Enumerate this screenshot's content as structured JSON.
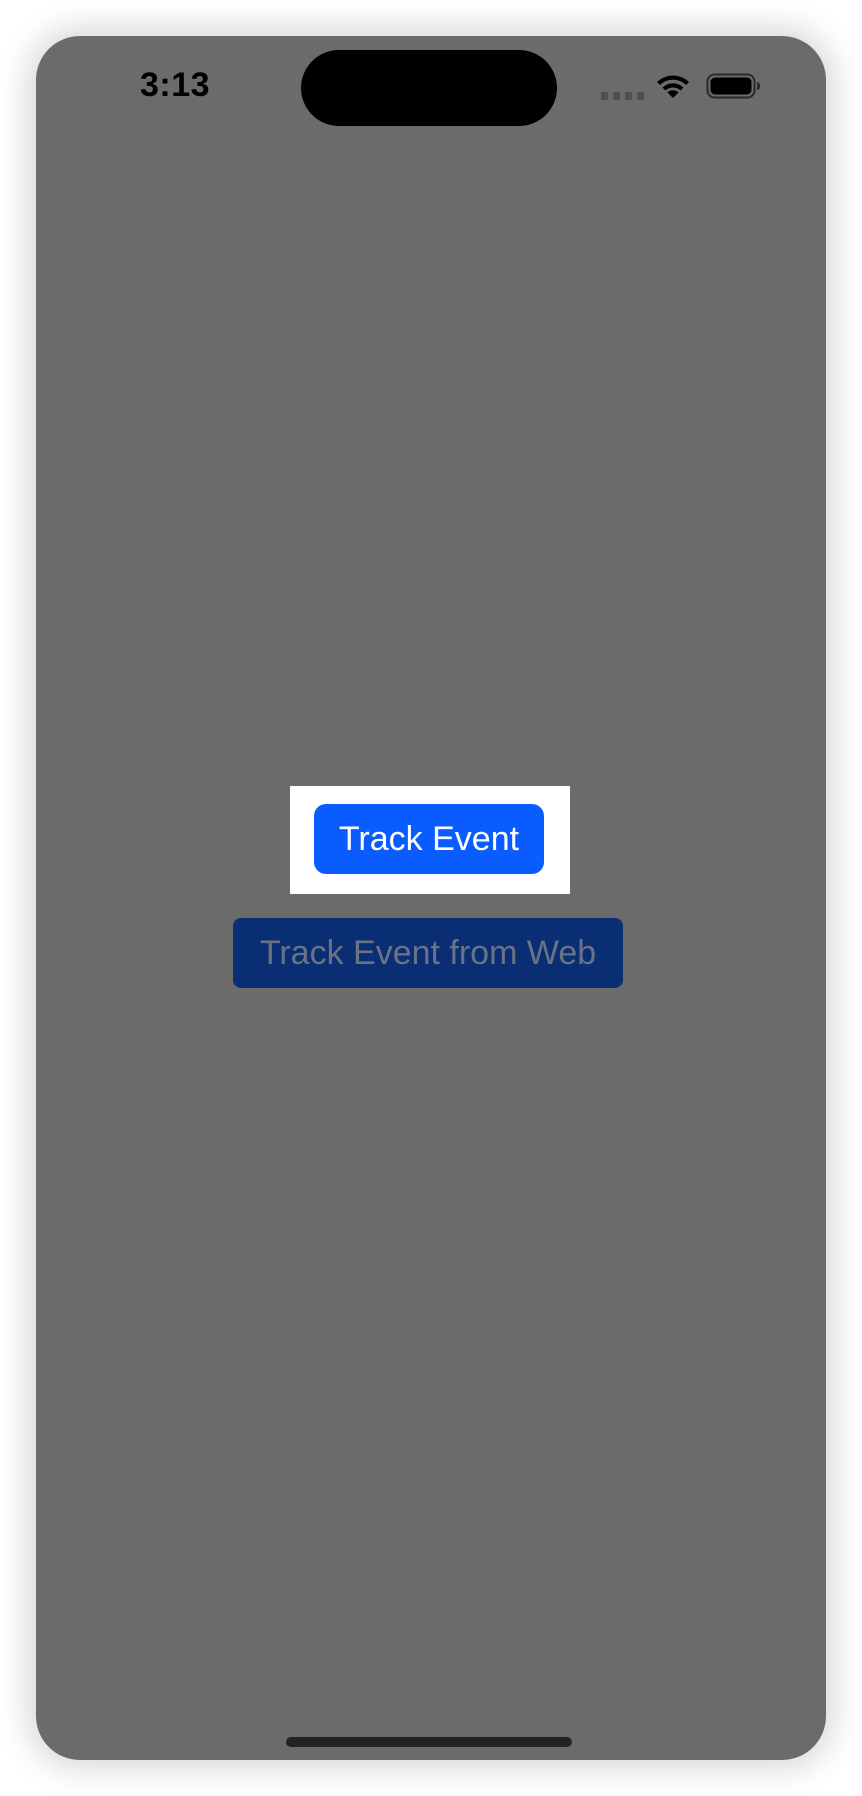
{
  "status_bar": {
    "time": "3:13",
    "signal_icon": "cellular-signal-icon",
    "wifi_icon": "wifi-icon",
    "battery_icon": "battery-icon"
  },
  "main": {
    "track_event_label": "Track Event",
    "track_event_web_label": "Track Event from Web"
  },
  "colors": {
    "screen_background": "#6b6b6b",
    "primary_button": "#0a5cff",
    "dimmed_button": "#092e74",
    "highlight_box": "#ffffff"
  }
}
